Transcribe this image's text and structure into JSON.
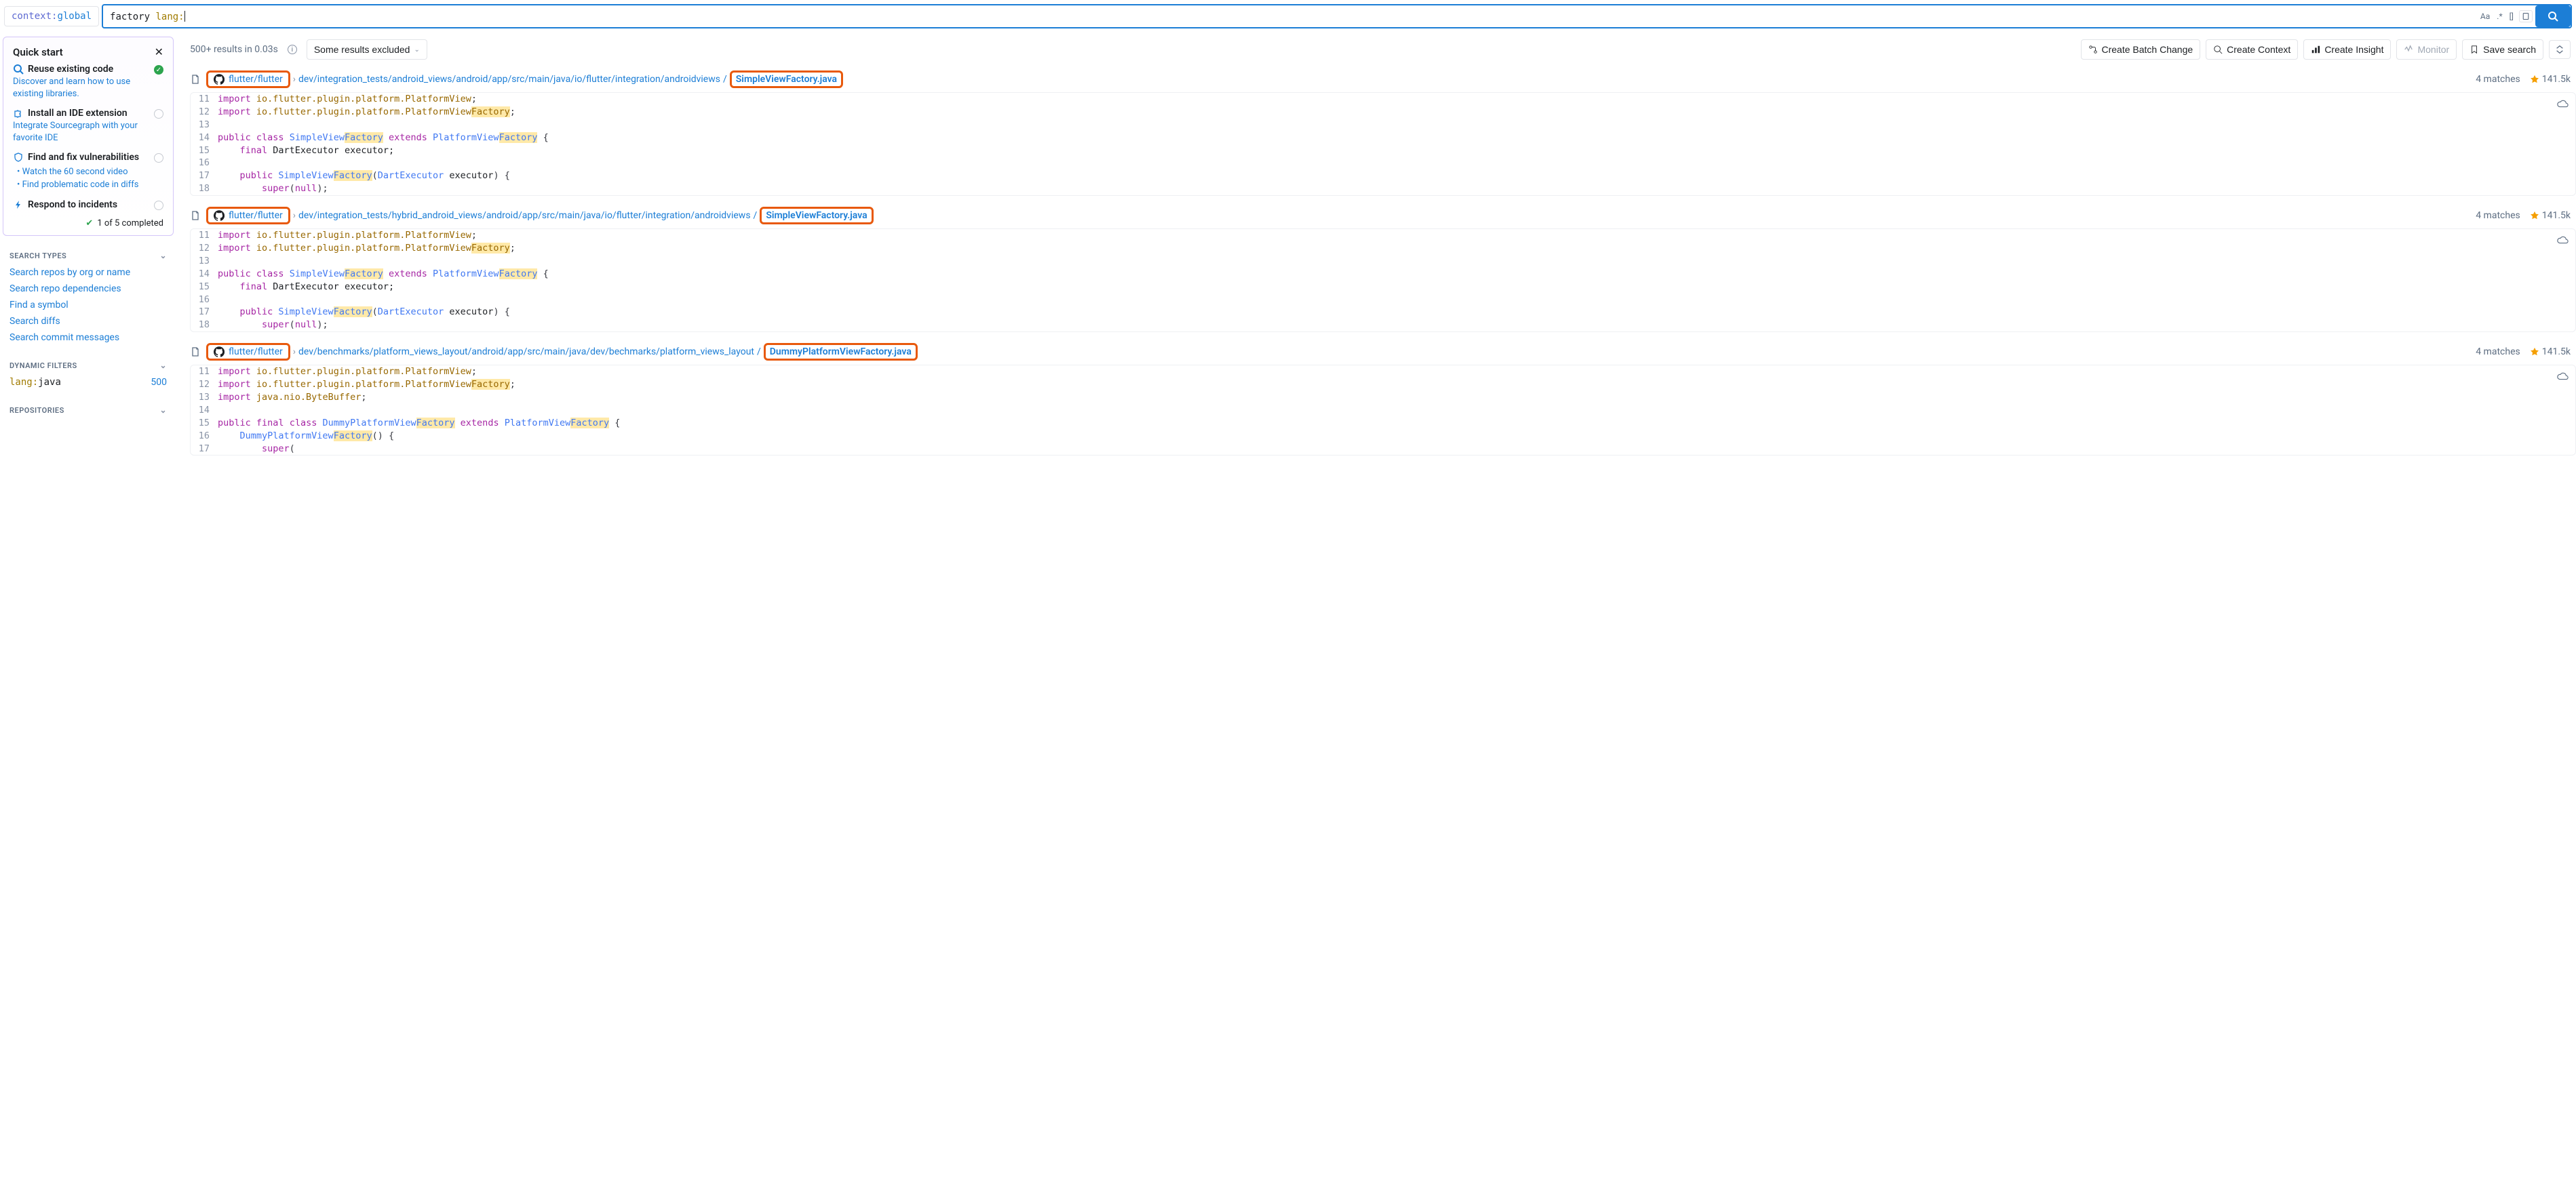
{
  "search": {
    "context_key": "context:",
    "context_value": "global",
    "query_term": "factory",
    "query_filter": "lang:",
    "tools": {
      "case": "Aa",
      "regex": ".*",
      "structural": "[]"
    }
  },
  "quick_start": {
    "title": "Quick start",
    "items": [
      {
        "icon": "search",
        "title": "Reuse existing code",
        "desc": "Discover and learn how to use existing libraries.",
        "done": true
      },
      {
        "icon": "puzzle",
        "title": "Install an IDE extension",
        "desc": "Integrate Sourcegraph with your favorite IDE",
        "done": false
      },
      {
        "icon": "shield",
        "title": "Find and fix vulnerabilities",
        "done": false,
        "sub": [
          "Watch the 60 second video",
          "Find problematic code in diffs"
        ]
      },
      {
        "icon": "bolt",
        "title": "Respond to incidents",
        "done": false
      }
    ],
    "progress": "1 of 5 completed"
  },
  "sidebar": {
    "search_types": {
      "title": "SEARCH TYPES",
      "links": [
        "Search repos by org or name",
        "Search repo dependencies",
        "Find a symbol",
        "Search diffs",
        "Search commit messages"
      ]
    },
    "dynamic_filters": {
      "title": "DYNAMIC FILTERS",
      "filters": [
        {
          "key": "lang:",
          "value": "java",
          "count": "500"
        }
      ]
    },
    "repositories": {
      "title": "REPOSITORIES"
    }
  },
  "results_meta": {
    "summary": "500+ results in 0.03s",
    "excluded": "Some results excluded"
  },
  "toolbar": {
    "batch": "Create Batch Change",
    "context": "Create Context",
    "insight": "Create Insight",
    "monitor": "Monitor",
    "save": "Save search"
  },
  "results": [
    {
      "repo": "flutter/flutter",
      "path_prefix": "dev/integration_tests/android_views/android/app/src/main/java/io/flutter/integration/androidviews",
      "filename": "SimpleViewFactory.java",
      "matches": "4 matches",
      "stars": "141.5k",
      "code": [
        {
          "n": "11",
          "frags": [
            {
              "t": "import ",
              "c": "kw"
            },
            {
              "t": "io.flutter.plugin.platform.PlatformView",
              "c": "pkg"
            },
            {
              "t": ";",
              "c": "sym"
            }
          ]
        },
        {
          "n": "12",
          "frags": [
            {
              "t": "import ",
              "c": "kw"
            },
            {
              "t": "io.flutter.plugin.platform.PlatformView",
              "c": "pkg"
            },
            {
              "t": "Factory",
              "c": "pkg",
              "hl": true
            },
            {
              "t": ";",
              "c": "sym"
            }
          ]
        },
        {
          "n": "13",
          "frags": [
            {
              "t": "",
              "c": ""
            }
          ]
        },
        {
          "n": "14",
          "frags": [
            {
              "t": "public ",
              "c": "kw"
            },
            {
              "t": "class ",
              "c": "kw"
            },
            {
              "t": "SimpleView",
              "c": "cls"
            },
            {
              "t": "Factory",
              "c": "cls",
              "hl": true
            },
            {
              "t": " extends ",
              "c": "kw"
            },
            {
              "t": "PlatformView",
              "c": "cls"
            },
            {
              "t": "Factory",
              "c": "cls",
              "hl": true
            },
            {
              "t": " {",
              "c": "sym"
            }
          ]
        },
        {
          "n": "15",
          "frags": [
            {
              "t": "    final ",
              "c": "kw"
            },
            {
              "t": "DartExecutor executor;",
              "c": "fn"
            }
          ]
        },
        {
          "n": "16",
          "frags": [
            {
              "t": "",
              "c": ""
            }
          ]
        },
        {
          "n": "17",
          "frags": [
            {
              "t": "    public ",
              "c": "kw"
            },
            {
              "t": "SimpleView",
              "c": "cls"
            },
            {
              "t": "Factory",
              "c": "cls",
              "hl": true
            },
            {
              "t": "(",
              "c": "sym"
            },
            {
              "t": "DartExecutor ",
              "c": "cls"
            },
            {
              "t": "executor",
              "c": "fn"
            },
            {
              "t": ") {",
              "c": "sym"
            }
          ]
        },
        {
          "n": "18",
          "frags": [
            {
              "t": "        super",
              "c": "kw"
            },
            {
              "t": "(",
              "c": "sym"
            },
            {
              "t": "null",
              "c": "kw"
            },
            {
              "t": ");",
              "c": "sym"
            }
          ]
        }
      ]
    },
    {
      "repo": "flutter/flutter",
      "path_prefix": "dev/integration_tests/hybrid_android_views/android/app/src/main/java/io/flutter/integration/androidviews",
      "filename": "SimpleViewFactory.java",
      "matches": "4 matches",
      "stars": "141.5k",
      "code": [
        {
          "n": "11",
          "frags": [
            {
              "t": "import ",
              "c": "kw"
            },
            {
              "t": "io.flutter.plugin.platform.PlatformView",
              "c": "pkg"
            },
            {
              "t": ";",
              "c": "sym"
            }
          ]
        },
        {
          "n": "12",
          "frags": [
            {
              "t": "import ",
              "c": "kw"
            },
            {
              "t": "io.flutter.plugin.platform.PlatformView",
              "c": "pkg"
            },
            {
              "t": "Factory",
              "c": "pkg",
              "hl": true
            },
            {
              "t": ";",
              "c": "sym"
            }
          ]
        },
        {
          "n": "13",
          "frags": [
            {
              "t": "",
              "c": ""
            }
          ]
        },
        {
          "n": "14",
          "frags": [
            {
              "t": "public ",
              "c": "kw"
            },
            {
              "t": "class ",
              "c": "kw"
            },
            {
              "t": "SimpleView",
              "c": "cls"
            },
            {
              "t": "Factory",
              "c": "cls",
              "hl": true
            },
            {
              "t": " extends ",
              "c": "kw"
            },
            {
              "t": "PlatformView",
              "c": "cls"
            },
            {
              "t": "Factory",
              "c": "cls",
              "hl": true
            },
            {
              "t": " {",
              "c": "sym"
            }
          ]
        },
        {
          "n": "15",
          "frags": [
            {
              "t": "    final ",
              "c": "kw"
            },
            {
              "t": "DartExecutor executor;",
              "c": "fn"
            }
          ]
        },
        {
          "n": "16",
          "frags": [
            {
              "t": "",
              "c": ""
            }
          ]
        },
        {
          "n": "17",
          "frags": [
            {
              "t": "    public ",
              "c": "kw"
            },
            {
              "t": "SimpleView",
              "c": "cls"
            },
            {
              "t": "Factory",
              "c": "cls",
              "hl": true
            },
            {
              "t": "(",
              "c": "sym"
            },
            {
              "t": "DartExecutor ",
              "c": "cls"
            },
            {
              "t": "executor",
              "c": "fn"
            },
            {
              "t": ") {",
              "c": "sym"
            }
          ]
        },
        {
          "n": "18",
          "frags": [
            {
              "t": "        super",
              "c": "kw"
            },
            {
              "t": "(",
              "c": "sym"
            },
            {
              "t": "null",
              "c": "kw"
            },
            {
              "t": ");",
              "c": "sym"
            }
          ]
        }
      ]
    },
    {
      "repo": "flutter/flutter",
      "path_prefix": "dev/benchmarks/platform_views_layout/android/app/src/main/java/dev/bechmarks/platform_views_layout",
      "filename": "DummyPlatformViewFactory.java",
      "matches": "4 matches",
      "stars": "141.5k",
      "code": [
        {
          "n": "11",
          "frags": [
            {
              "t": "import ",
              "c": "kw"
            },
            {
              "t": "io.flutter.plugin.platform.PlatformView",
              "c": "pkg"
            },
            {
              "t": ";",
              "c": "sym"
            }
          ]
        },
        {
          "n": "12",
          "frags": [
            {
              "t": "import ",
              "c": "kw"
            },
            {
              "t": "io.flutter.plugin.platform.PlatformView",
              "c": "pkg"
            },
            {
              "t": "Factory",
              "c": "pkg",
              "hl": true
            },
            {
              "t": ";",
              "c": "sym"
            }
          ]
        },
        {
          "n": "13",
          "frags": [
            {
              "t": "import ",
              "c": "kw"
            },
            {
              "t": "java.nio.ByteBuffer",
              "c": "pkg"
            },
            {
              "t": ";",
              "c": "sym"
            }
          ]
        },
        {
          "n": "14",
          "frags": [
            {
              "t": "",
              "c": ""
            }
          ]
        },
        {
          "n": "15",
          "frags": [
            {
              "t": "public ",
              "c": "kw"
            },
            {
              "t": "final ",
              "c": "kw"
            },
            {
              "t": "class ",
              "c": "kw"
            },
            {
              "t": "DummyPlatformView",
              "c": "cls"
            },
            {
              "t": "Factory",
              "c": "cls",
              "hl": true
            },
            {
              "t": " extends ",
              "c": "kw"
            },
            {
              "t": "PlatformView",
              "c": "cls"
            },
            {
              "t": "Factory",
              "c": "cls",
              "hl": true
            },
            {
              "t": " {",
              "c": "sym"
            }
          ]
        },
        {
          "n": "16",
          "frags": [
            {
              "t": "    DummyPlatformView",
              "c": "cls"
            },
            {
              "t": "Factory",
              "c": "cls",
              "hl": true
            },
            {
              "t": "() {",
              "c": "sym"
            }
          ]
        },
        {
          "n": "17",
          "frags": [
            {
              "t": "        super",
              "c": "kw"
            },
            {
              "t": "(",
              "c": "sym"
            }
          ]
        }
      ]
    }
  ]
}
